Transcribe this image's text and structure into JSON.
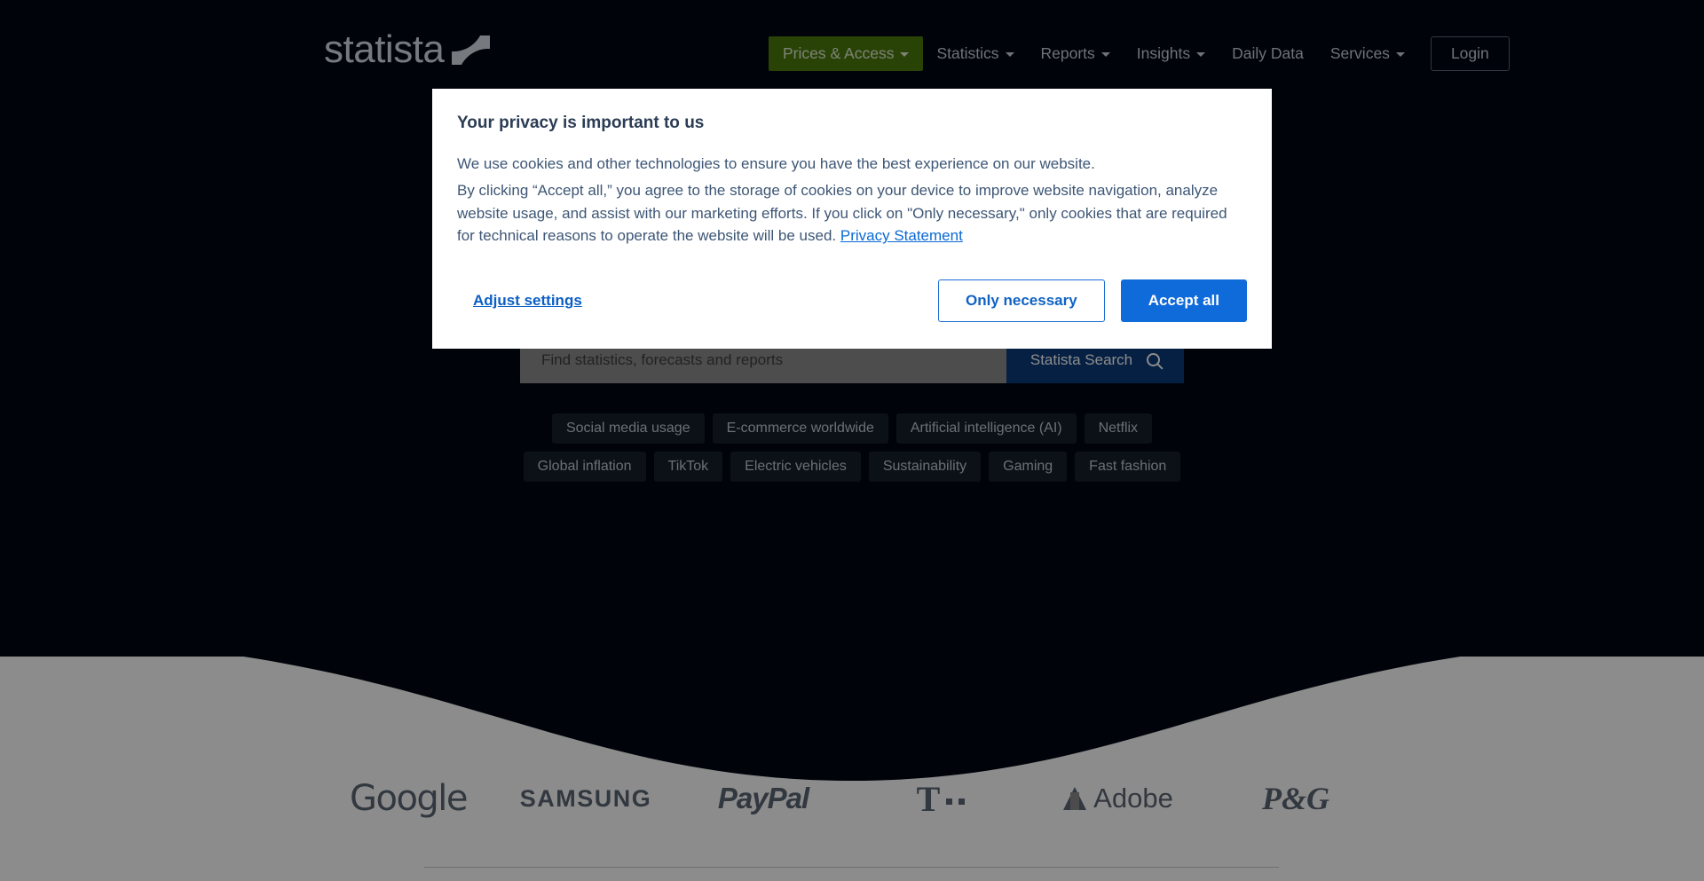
{
  "header": {
    "logo_text": "statista",
    "logo_mark_name": "statista-swoosh-mark",
    "nav": [
      {
        "label": "Prices & Access",
        "has_caret": true,
        "highlighted": true
      },
      {
        "label": "Statistics",
        "has_caret": true,
        "highlighted": false
      },
      {
        "label": "Reports",
        "has_caret": true,
        "highlighted": false
      },
      {
        "label": "Insights",
        "has_caret": true,
        "highlighted": false
      },
      {
        "label": "Daily Data",
        "has_caret": false,
        "highlighted": false
      },
      {
        "label": "Services",
        "has_caret": true,
        "highlighted": false
      }
    ],
    "login_label": "Login",
    "highlight_color": "#4b7a0b"
  },
  "search": {
    "placeholder": "Find statistics, forecasts and reports",
    "value": "",
    "button_label": "Statista Search",
    "button_color": "#0b3b7a",
    "icon": "search-icon"
  },
  "tags": {
    "row1": [
      "Social media usage",
      "E-commerce worldwide",
      "Artificial intelligence (AI)",
      "Netflix"
    ],
    "row2": [
      "Global inflation",
      "TikTok",
      "Electric vehicles",
      "Sustainability",
      "Gaming",
      "Fast fashion"
    ]
  },
  "brands": [
    {
      "name": "Google"
    },
    {
      "name": "SAMSUNG"
    },
    {
      "name": "PayPal"
    },
    {
      "name": "T"
    },
    {
      "name": "Adobe"
    },
    {
      "name": "P&G"
    }
  ],
  "cookie_dialog": {
    "title": "Your privacy is important to us",
    "paragraph1": "We use cookies and other technologies to ensure you have the best experience on our website.",
    "paragraph2_a": "By clicking “Accept all,” you agree to the storage of cookies on your device to improve website navigation, analyze website usage, and assist with our marketing efforts. If you click on \"Only necessary,\" only cookies that are required for technical reasons to operate the website will be used. ",
    "privacy_link": "Privacy Statement",
    "adjust_settings": "Adjust settings",
    "only_necessary": "Only necessary",
    "accept_all": "Accept all",
    "primary_color": "#0f6ada",
    "link_color": "#0b5ec4"
  }
}
